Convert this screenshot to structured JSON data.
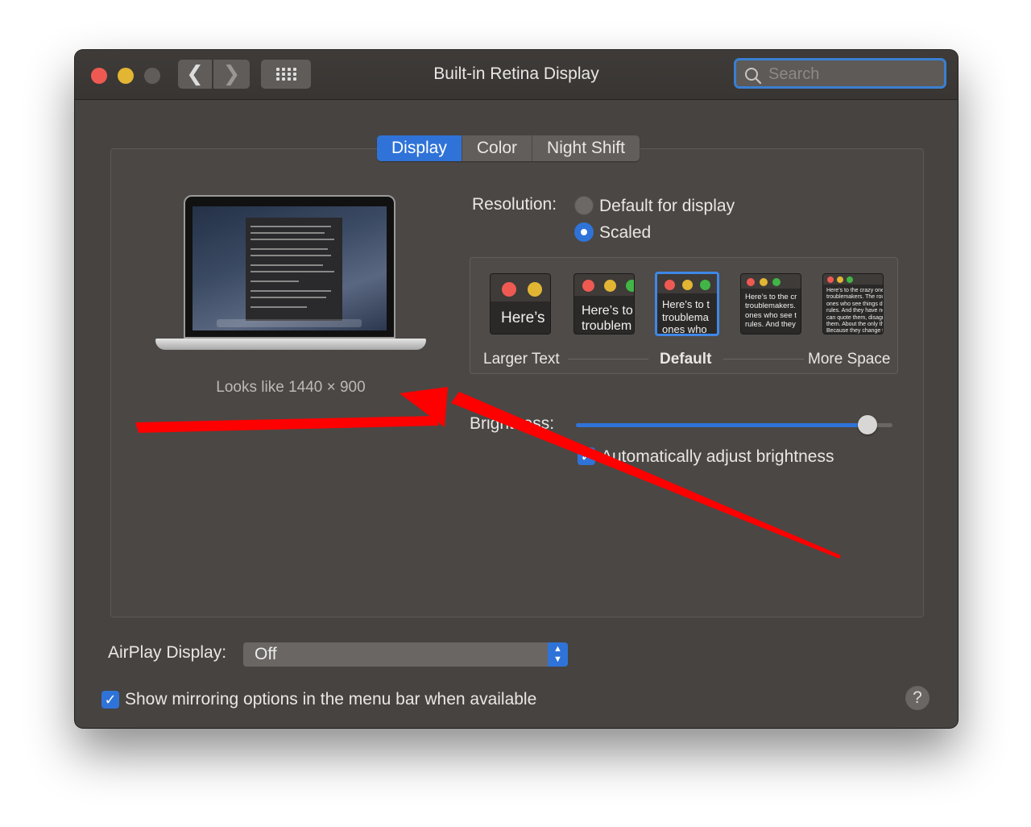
{
  "window": {
    "title": "Built-in Retina Display",
    "search_placeholder": "Search"
  },
  "toolbar": {
    "back_glyph": "❮",
    "forward_glyph": "❯"
  },
  "tabs": [
    {
      "label": "Display",
      "active": true
    },
    {
      "label": "Color",
      "active": false
    },
    {
      "label": "Night Shift",
      "active": false
    }
  ],
  "preview": {
    "looks_like": "Looks like 1440 × 900"
  },
  "resolution": {
    "label": "Resolution:",
    "options": [
      {
        "label": "Default for display",
        "selected": false
      },
      {
        "label": "Scaled",
        "selected": true
      }
    ]
  },
  "scaled_options": {
    "thumbs": [
      {
        "text": "Here’s"
      },
      {
        "text": "Here’s to\ntroublem"
      },
      {
        "text": "Here’s to t\ntroublema\nones who"
      },
      {
        "text": "Here’s to the cr\ntroublemakers.\nones who see t\nrules. And they"
      },
      {
        "text": "Here’s to the crazy one\ntroublemakers. The rou\nones who see things dif\nrules. And they have no\ncan quote them, disagr\nthem. About the only th\nBecause they change t"
      }
    ],
    "left_label": "Larger Text",
    "center_label": "Default",
    "right_label": "More Space"
  },
  "brightness": {
    "label": "Brightness:",
    "level": 0.92,
    "auto_label": "Automatically adjust brightness",
    "auto_checked": true
  },
  "airplay": {
    "label": "AirPlay Display:",
    "value": "Off"
  },
  "mirroring": {
    "label": "Show mirroring options in the menu bar when available",
    "checked": true
  },
  "help_label": "?",
  "colors": {
    "accent": "#2f73d8",
    "window_bg": "#474340",
    "arrow": "#ff0000"
  }
}
